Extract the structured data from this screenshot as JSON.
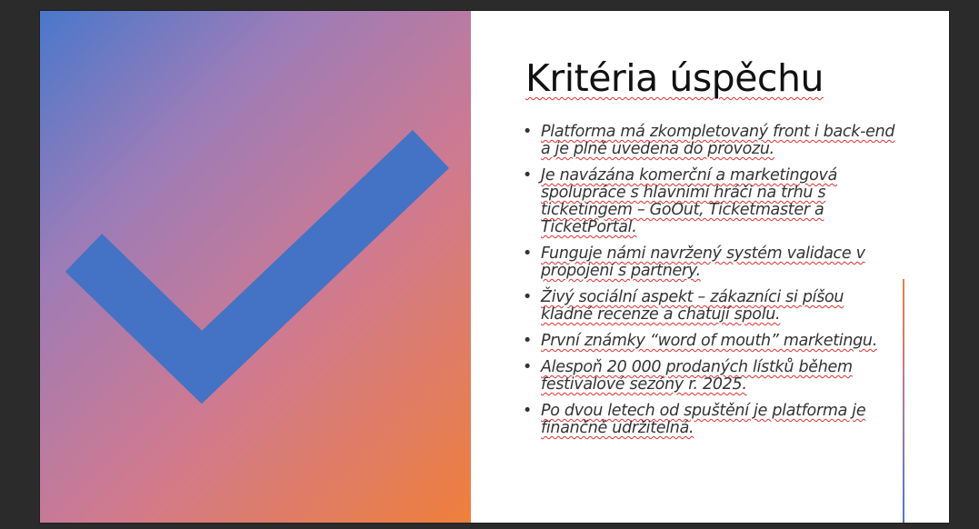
{
  "slide": {
    "title": "Kritéria úspěchu",
    "bullets": [
      "Platforma má zkompletovaný front i back-end a je plně uvedena do provozu.",
      "Je navázána komerční a marketingová spolupráce s hlavními hráči na trhu s ticketingem – GoOut, Ticketmaster a TicketPortal.",
      "Funguje námi navržený systém validace v propojení s partnery.",
      "Živý sociální aspekt – zákazníci si píšou kladné recenze a chatují spolu.",
      "První známky “word of mouth” marketingu.",
      "Alespoň 20 000 prodaných lístků během festivalové sezóny r. 2025.",
      "Po dvou letech od spuštění je platforma je finančně udržitelná."
    ],
    "bullet_symbol": "•"
  },
  "icons": {
    "checkmark": "checkmark-icon"
  },
  "colors": {
    "background": "#2b2b2b",
    "slide": "#ffffff",
    "checkmark": "#4472c4",
    "gradient_start": "#4a78cb",
    "gradient_end": "#ef7f3b",
    "spellcheck_underline": "#e03030"
  }
}
